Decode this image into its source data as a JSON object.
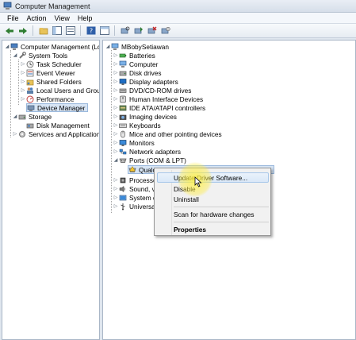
{
  "window": {
    "title": "Computer Management"
  },
  "menu": [
    "File",
    "Action",
    "View",
    "Help"
  ],
  "left_tree": {
    "root": "Computer Management (Local",
    "system_tools": "System Tools",
    "items": [
      "Task Scheduler",
      "Event Viewer",
      "Shared Folders",
      "Local Users and Groups",
      "Performance",
      "Device Manager"
    ],
    "storage": "Storage",
    "disk_management": "Disk Management",
    "services": "Services and Applications"
  },
  "device_tree": {
    "root": "MBobySetiawan",
    "categories": [
      "Batteries",
      "Computer",
      "Disk drives",
      "Display adapters",
      "DVD/CD-ROM drives",
      "Human Interface Devices",
      "IDE ATA/ATAPI controllers",
      "Imaging devices",
      "Keyboards",
      "Mice and other pointing devices",
      "Monitors",
      "Network adapters",
      "Ports (COM & LPT)"
    ],
    "port_device": "Qualcomm HS-USB QDLoader 9008 (COM3)",
    "after": [
      "Processors",
      "Sound, vi",
      "System d",
      "Universal"
    ]
  },
  "context_menu": {
    "update": "Update Driver Software...",
    "disable": "Disable",
    "uninstall": "Uninstall",
    "scan": "Scan for hardware changes",
    "properties": "Properties"
  },
  "colors": {
    "selection": "#d6e4f4",
    "highlight": "#ffeb3c"
  }
}
